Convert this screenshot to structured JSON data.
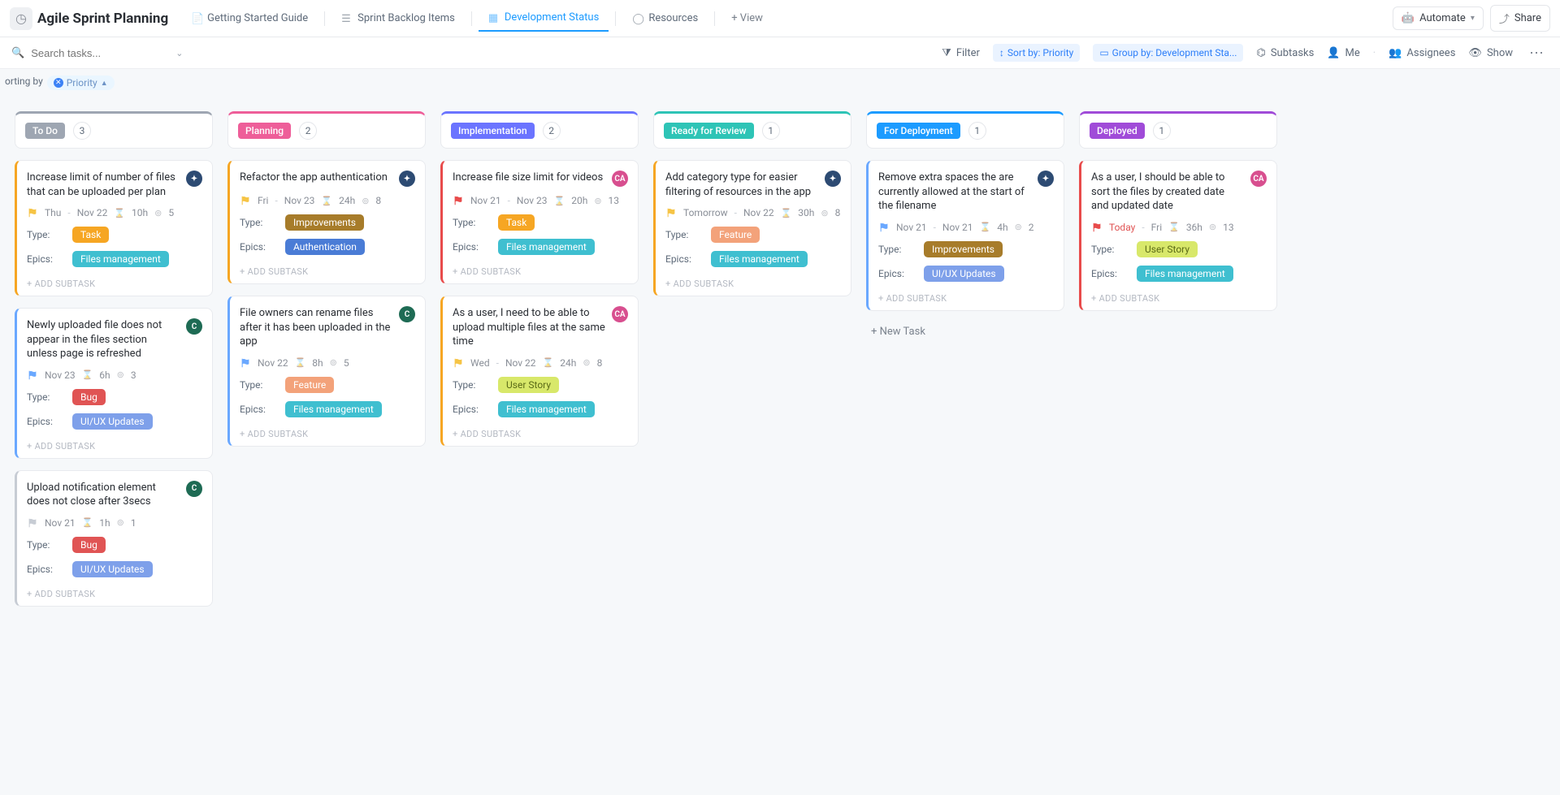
{
  "header": {
    "title": "Agile Sprint Planning",
    "tabs": [
      {
        "label": "Getting Started Guide"
      },
      {
        "label": "Sprint Backlog Items"
      },
      {
        "label": "Development Status",
        "active": true
      },
      {
        "label": "Resources"
      }
    ],
    "add_view": "+ View",
    "automate": "Automate",
    "share": "Share"
  },
  "toolbar": {
    "search_placeholder": "Search tasks...",
    "filter": "Filter",
    "sort": "Sort by: Priority",
    "group": "Group by: Development Sta...",
    "subtasks": "Subtasks",
    "me": "Me",
    "assignees": "Assignees",
    "show": "Show"
  },
  "sortbar": {
    "label": "orting by",
    "chip": "Priority",
    "arrow": "▲"
  },
  "common": {
    "type_label": "Type:",
    "epics_label": "Epics:",
    "add_subtask": "+ ADD SUBTASK",
    "new_task": "+ New Task"
  },
  "columns": [
    {
      "name": "To Do",
      "color": "#9ea6b2",
      "count": 3,
      "cards": [
        {
          "title": "Increase limit of number of files that can be uploaded per plan",
          "border": "#f6a623",
          "avatar": {
            "bg": "#2d4b73",
            "init": "✦"
          },
          "flag": "yellow",
          "date1": "Thu",
          "date2": "Nov 22",
          "hours": "10h",
          "subs": "5",
          "type": {
            "cls": "t-task",
            "label": "Task"
          },
          "epic": {
            "cls": "e-files",
            "label": "Files management"
          }
        },
        {
          "title": "Newly uploaded file does not appear in the files section unless page is refreshed",
          "border": "#6aa8ff",
          "avatar": {
            "bg": "#1e6b54",
            "init": "C"
          },
          "flag": "blue",
          "date1": "Nov 23",
          "date2": "",
          "hours": "6h",
          "subs": "3",
          "type": {
            "cls": "t-bug",
            "label": "Bug"
          },
          "epic": {
            "cls": "e-uiux",
            "label": "UI/UX Updates"
          }
        },
        {
          "title": "Upload notification element does not close after 3secs",
          "border": "#c7ccd4",
          "avatar": {
            "bg": "#1e6b54",
            "init": "C"
          },
          "flag": "grey",
          "date1": "Nov 21",
          "date2": "",
          "hours": "1h",
          "subs": "1",
          "type": {
            "cls": "t-bug",
            "label": "Bug"
          },
          "epic": {
            "cls": "e-uiux",
            "label": "UI/UX Updates"
          }
        }
      ]
    },
    {
      "name": "Planning",
      "color": "#ee5e99",
      "count": 2,
      "cards": [
        {
          "title": "Refactor the app authentication",
          "border": "#f6a623",
          "avatar": {
            "bg": "#2d4b73",
            "init": "✦"
          },
          "flag": "yellow",
          "date1": "Fri",
          "date2": "Nov 23",
          "hours": "24h",
          "subs": "8",
          "type": {
            "cls": "t-improve",
            "label": "Improvements"
          },
          "epic": {
            "cls": "e-auth",
            "label": "Authentication"
          }
        },
        {
          "title": "File owners can rename files after it has been uploaded in the app",
          "border": "#6aa8ff",
          "avatar": {
            "bg": "#1e6b54",
            "init": "C"
          },
          "flag": "blue",
          "date1": "Nov 22",
          "date2": "",
          "hours": "8h",
          "subs": "5",
          "type": {
            "cls": "t-feature",
            "label": "Feature"
          },
          "epic": {
            "cls": "e-files",
            "label": "Files management"
          }
        }
      ]
    },
    {
      "name": "Implementation",
      "color": "#6b74ff",
      "count": 2,
      "cards": [
        {
          "title": "Increase file size limit for videos",
          "border": "#e84b4b",
          "avatar": {
            "bg": "#d84f8f",
            "init": "CA"
          },
          "flag": "red",
          "date1": "Nov 21",
          "date2": "Nov 23",
          "hours": "20h",
          "subs": "13",
          "type": {
            "cls": "t-task",
            "label": "Task"
          },
          "epic": {
            "cls": "e-files",
            "label": "Files management"
          }
        },
        {
          "title": "As a user, I need to be able to upload multiple files at the same time",
          "border": "#f6a623",
          "avatar": {
            "bg": "#d84f8f",
            "init": "CA"
          },
          "flag": "yellow",
          "date1": "Wed",
          "date2": "Nov 22",
          "hours": "24h",
          "subs": "8",
          "type": {
            "cls": "t-userstory",
            "label": "User Story"
          },
          "epic": {
            "cls": "e-files",
            "label": "Files management"
          }
        }
      ]
    },
    {
      "name": "Ready for Review",
      "color": "#2ec4b6",
      "count": 1,
      "cards": [
        {
          "title": "Add category type for easier filtering of resources in the app",
          "border": "#f6a623",
          "avatar": {
            "bg": "#2d4b73",
            "init": "✦"
          },
          "flag": "yellow",
          "date1": "Tomorrow",
          "date2": "Nov 22",
          "hours": "30h",
          "subs": "8",
          "type": {
            "cls": "t-feature",
            "label": "Feature"
          },
          "epic": {
            "cls": "e-files",
            "label": "Files management"
          }
        }
      ]
    },
    {
      "name": "For Deployment",
      "color": "#1c9bff",
      "count": 1,
      "cards": [
        {
          "title": "Remove extra spaces the are currently allowed at the start of the filename",
          "border": "#6aa8ff",
          "avatar": {
            "bg": "#2d4b73",
            "init": "✦"
          },
          "flag": "blue",
          "date1": "Nov 21",
          "date2": "Nov 21",
          "hours": "4h",
          "subs": "2",
          "type": {
            "cls": "t-improve",
            "label": "Improvements"
          },
          "epic": {
            "cls": "e-uiux",
            "label": "UI/UX Updates"
          }
        }
      ],
      "show_new_task": true
    },
    {
      "name": "Deployed",
      "color": "#a04bd8",
      "count": 1,
      "cards": [
        {
          "title": "As a user, I should be able to sort the files by created date and updated date",
          "border": "#e84b4b",
          "avatar": {
            "bg": "#d84f8f",
            "init": "CA"
          },
          "flag": "red",
          "date1": "Today",
          "date1_red": true,
          "date2": "Fri",
          "hours": "36h",
          "subs": "13",
          "type": {
            "cls": "t-userstory",
            "label": "User Story"
          },
          "epic": {
            "cls": "e-files",
            "label": "Files management"
          }
        }
      ]
    }
  ]
}
